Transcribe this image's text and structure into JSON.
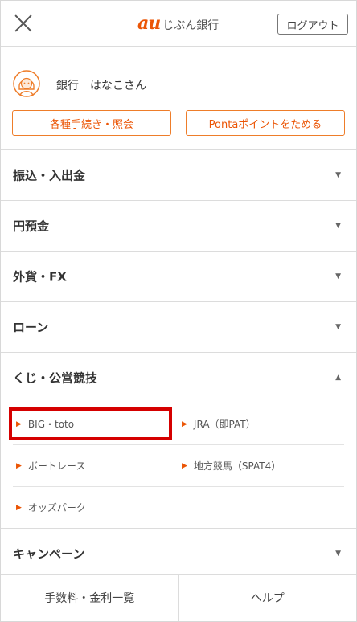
{
  "header": {
    "logo_mark": "au",
    "logo_text": "じぶん銀行",
    "logout_label": "ログアウト",
    "close_icon": "close-icon"
  },
  "user": {
    "name": "銀行　はなこさん",
    "avatar_icon": "user-avatar-icon",
    "procedures_label": "各種手続き・照会",
    "ponta_label": "Pontaポイントをためる"
  },
  "menu": {
    "transfer": "振込・入出金",
    "yen_deposit": "円預金",
    "foreign": "外貨・FX",
    "loan": "ローン",
    "lottery": "くじ・公営競技",
    "campaign": "キャンペーン"
  },
  "lottery_sub": {
    "big_toto": "BIG・toto",
    "jra": "JRA（即PAT）",
    "boatrace": "ボートレース",
    "local_race": "地方競馬（SPAT4）",
    "odds_park": "オッズパーク"
  },
  "footer": {
    "fees": "手数料・金利一覧",
    "help": "ヘルプ"
  },
  "colors": {
    "accent": "#eb5505",
    "highlight": "#d50000"
  }
}
